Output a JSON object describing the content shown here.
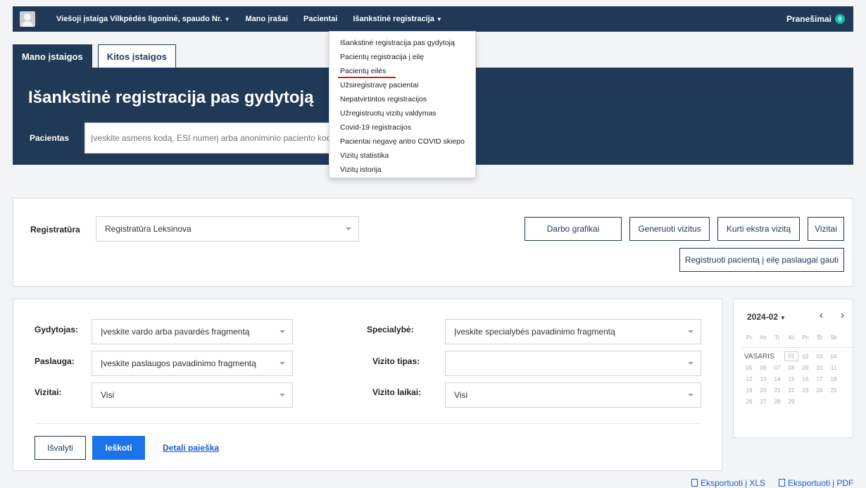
{
  "nav": {
    "institution": "Viešoji įstaiga Vilkpėdės ligoninė, spaudo Nr.",
    "my_records": "Mano įrašai",
    "patients": "Pacientai",
    "preregistration": "Išankstinė registracija",
    "notifications": "Pranešimai",
    "notifications_count": "0"
  },
  "menu": {
    "items": [
      "Išankstinė registracija pas gydytoją",
      "Pacientų registracija į eilę",
      "Pacientų eilės",
      "Užsiregistravę pacientai",
      "Nepatvirtintos registracijos",
      "Užregistruotų vizitų valdymas",
      "Covid-19 registracijos",
      "Pacientai negavę antro COVID skiepo",
      "Vizitų statistika",
      "Vizitų istorija"
    ]
  },
  "tabs": {
    "my": "Mano įstaigos",
    "other": "Kitos įstaigos"
  },
  "hero": {
    "title": "Išankstinė registracija pas gydytoją",
    "patient_label": "Pacientas",
    "patient_placeholder": "Įveskite asmens kodą, ESI numerį arba anoniminio paciento kodą"
  },
  "reception": {
    "label": "Registratūra",
    "value": "Registratūra Leksinova",
    "buttons": {
      "schedules": "Darbo grafikai",
      "generate": "Generuoti vizitus",
      "extra": "Kurti ekstra vizitą",
      "visits": "Vizitai",
      "queue": "Registruoti pacientą į eilę paslaugai gauti"
    }
  },
  "filters": {
    "doctor_label": "Gydytojas:",
    "doctor_value": "Įveskite vardo arba pavardės fragmentą",
    "service_label": "Paslauga:",
    "service_value": "Įveskite paslaugos pavadinimo fragmentą",
    "visits_label": "Vizitai:",
    "visits_value": "Visi",
    "specialty_label": "Specialybė:",
    "specialty_value": "Įveskite specialybės pavadinimo fragmentą",
    "visit_type_label": "Vizito tipas:",
    "visit_type_value": "",
    "visit_times_label": "Vizito laikai:",
    "visit_times_value": "Visi",
    "clear": "Išvalyti",
    "search": "Ieškoti",
    "detailed": "Detali paieška"
  },
  "calendar": {
    "month_label": "2024-02",
    "prev": "‹",
    "next": "›",
    "weekdays": [
      "Pr",
      "An",
      "Tr",
      "Kt",
      "Pn",
      "Št",
      "Sk"
    ],
    "month_name": "VASARIS",
    "first_row": [
      "01",
      "02",
      "03",
      "04"
    ],
    "rows": [
      [
        "05",
        "06",
        "07",
        "08",
        "09",
        "10",
        "11"
      ],
      [
        "12",
        "13",
        "14",
        "15",
        "16",
        "17",
        "18"
      ],
      [
        "19",
        "20",
        "21",
        "22",
        "23",
        "24",
        "25"
      ],
      [
        "26",
        "27",
        "28",
        "29"
      ]
    ]
  },
  "export": {
    "xls": "Eksportuoti į XLS",
    "pdf": "Eksportuoti į PDF"
  }
}
